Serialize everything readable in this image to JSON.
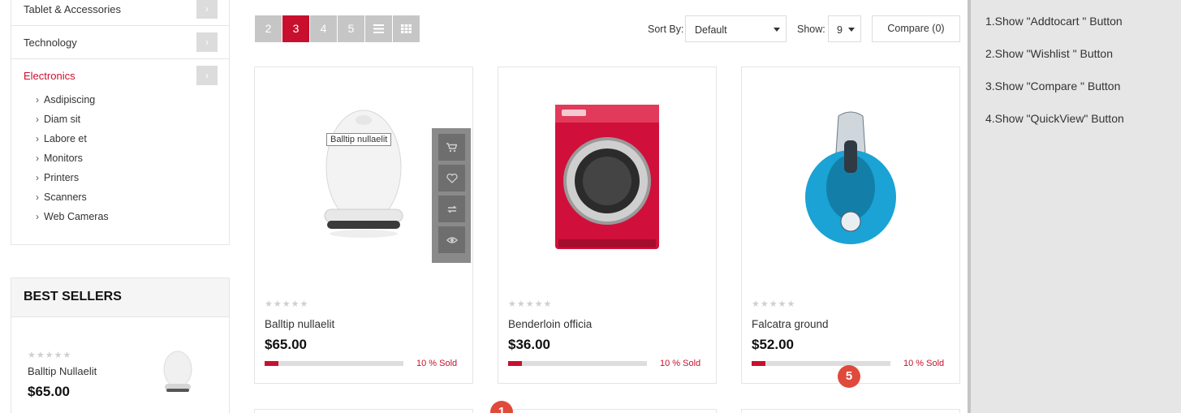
{
  "categories": {
    "items": [
      {
        "label": "Tablet & Accessories",
        "active": false
      },
      {
        "label": "Technology",
        "active": false
      },
      {
        "label": "Electronics",
        "active": true
      }
    ],
    "subcategories": [
      "Asdipiscing",
      "Diam sit",
      "Labore et",
      "Monitors",
      "Printers",
      "Scanners",
      "Web Cameras"
    ]
  },
  "best_sellers": {
    "title": "BEST SELLERS",
    "item": {
      "name": "Balltip Nullaelit",
      "price": "$65.00",
      "rating": 0
    }
  },
  "toolbar": {
    "pages": [
      "2",
      "3",
      "4",
      "5"
    ],
    "active_page": "3",
    "sort_label": "Sort By:",
    "sort_value": "Default",
    "show_label": "Show:",
    "show_value": "9",
    "compare_label": "Compare (0)"
  },
  "products": [
    {
      "name": "Balltip nullaelit",
      "price": "$65.00",
      "sold_text": "10 % Sold",
      "sold_fraction": 0.1,
      "rating": 0,
      "tooltip": "Balltip nullaelit",
      "image": "white-speaker"
    },
    {
      "name": "Benderloin officia",
      "price": "$36.00",
      "sold_text": "10 % Sold",
      "sold_fraction": 0.1,
      "rating": 0,
      "image": "red-washing-machine"
    },
    {
      "name": "Falcatra ground",
      "price": "$52.00",
      "sold_text": "10 % Sold",
      "sold_fraction": 0.1,
      "rating": 0,
      "image": "blue-vacuum-cleaner"
    }
  ],
  "badges": [
    "5",
    "1"
  ],
  "options": [
    "1.Show \"Addtocart \" Button",
    "2.Show \"Wishlist \" Button",
    "3.Show \"Compare \" Button",
    "4.Show \"QuickView\" Button"
  ],
  "colors": {
    "accent": "#c8102e",
    "badge": "#e04a3b",
    "pager_bg": "#c6c6c6"
  }
}
